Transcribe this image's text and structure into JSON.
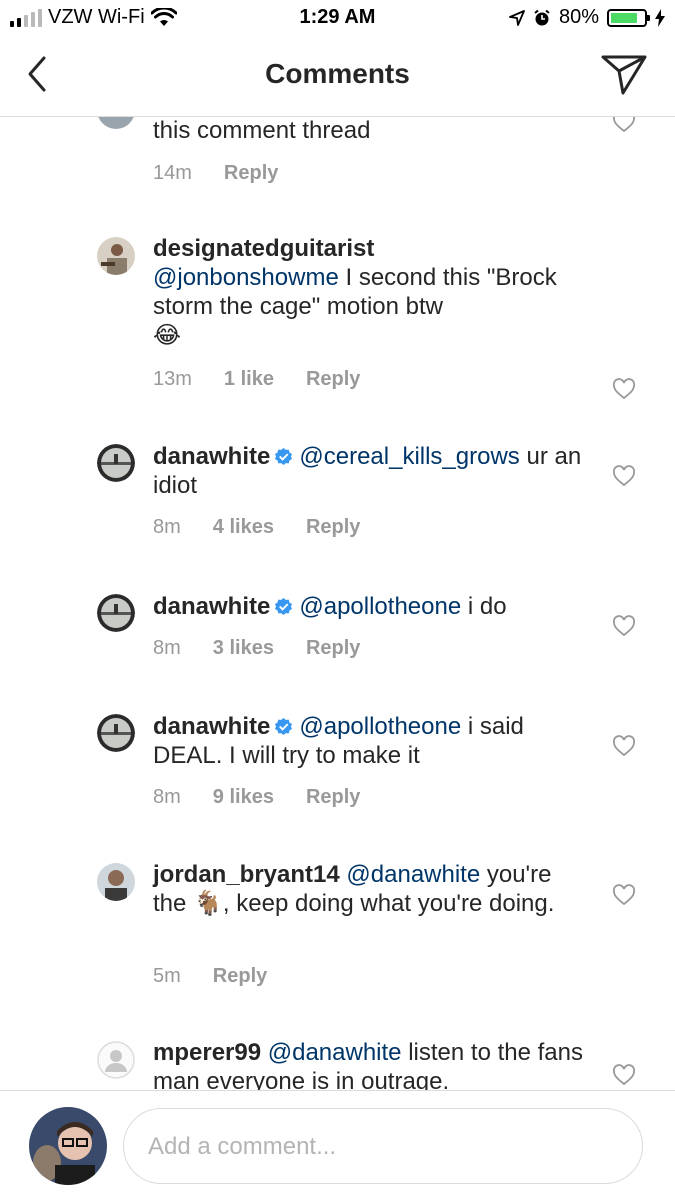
{
  "status_bar": {
    "carrier": "VZW Wi-Fi",
    "time": "1:29 AM",
    "battery": "80%",
    "battery_level": 0.8
  },
  "header": {
    "title": "Comments"
  },
  "comments": [
    {
      "text": "this comment thread",
      "time": "14m",
      "reply": "Reply"
    },
    {
      "user": "designatedguitarist",
      "mention": "@jonbonshowme",
      "text": " I second this \"Brock storm the cage\" motion btw",
      "emoji": "😂",
      "time": "13m",
      "likes": "1 like",
      "reply": "Reply"
    },
    {
      "user": "danawhite",
      "mention": "@cereal_kills_grows",
      "text": " ur an idiot",
      "time": "8m",
      "likes": "4 likes",
      "reply": "Reply"
    },
    {
      "user": "danawhite",
      "mention": "@apollotheone",
      "text": " i do",
      "time": "8m",
      "likes": "3 likes",
      "reply": "Reply"
    },
    {
      "user": "danawhite",
      "mention": "@apollotheone",
      "text": " i said DEAL. I will try to make it",
      "time": "8m",
      "likes": "9 likes",
      "reply": "Reply"
    },
    {
      "user": "jordan_bryant14",
      "mention": "@danawhite",
      "text_before": " you're the ",
      "emoji": "🐐",
      "text_after": ", keep doing what you're doing.",
      "time": "5m",
      "reply": "Reply"
    },
    {
      "user": "mperer99",
      "mention": "@danawhite",
      "text": " listen to the fans man everyone is in outrage."
    }
  ],
  "composer": {
    "placeholder": "Add a comment..."
  },
  "colors": {
    "mention": "#003569",
    "verified": "#3897f0",
    "meta": "#999999",
    "battery": "#4cd964"
  }
}
